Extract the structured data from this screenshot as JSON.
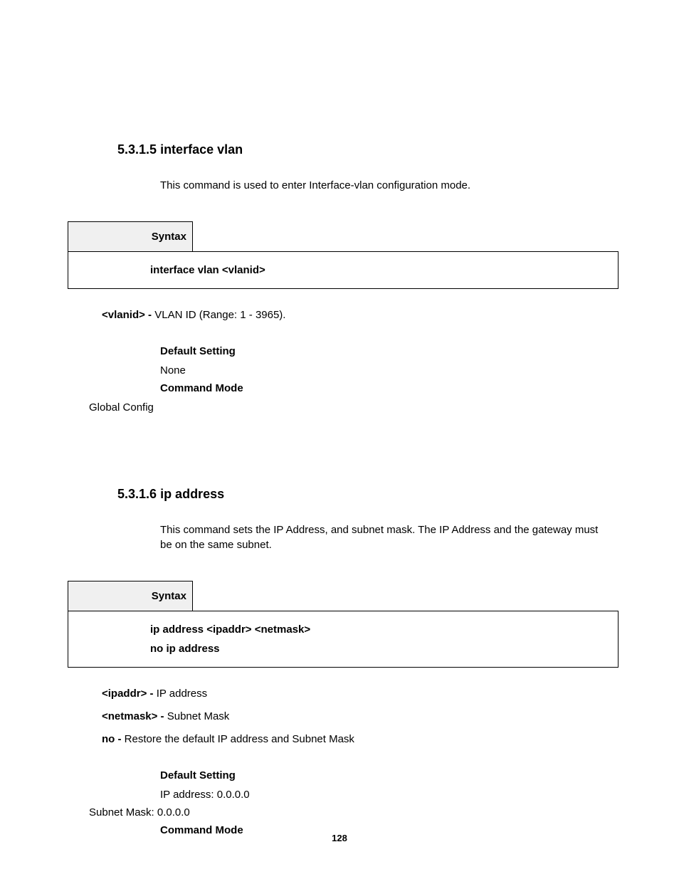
{
  "section1": {
    "number": "5.3.1.5",
    "title": "interface vlan",
    "description": "This command is used to enter Interface-vlan configuration mode.",
    "syntax_label": "Syntax",
    "syntax_command": "interface vlan <vlanid>",
    "params": [
      {
        "name": "<vlanid>",
        "dash": " - ",
        "desc": "VLAN ID (Range: 1 - 3965)."
      }
    ],
    "default_setting_label": "Default Setting",
    "default_setting_value": "None",
    "command_mode_label": "Command Mode",
    "command_mode_value": "Global Config"
  },
  "section2": {
    "number": "5.3.1.6",
    "title": "ip address",
    "description": "This command sets the IP Address, and subnet mask. The IP Address and the gateway must be on the same subnet.",
    "syntax_label": "Syntax",
    "syntax_command1": "ip address <ipaddr> <netmask>",
    "syntax_command2": "no ip address",
    "params": [
      {
        "name": "<ipaddr>",
        "dash": " - ",
        "desc": "IP address"
      },
      {
        "name": "<netmask>",
        "dash": " - ",
        "desc": "Subnet Mask"
      },
      {
        "name": "no",
        "dash": " - ",
        "desc": "Restore the default IP address and Subnet Mask"
      }
    ],
    "default_setting_label": "Default Setting",
    "default_setting_value1": "IP address: 0.0.0.0",
    "default_setting_value2": "Subnet Mask: 0.0.0.0",
    "command_mode_label": "Command Mode"
  },
  "page_number": "128"
}
